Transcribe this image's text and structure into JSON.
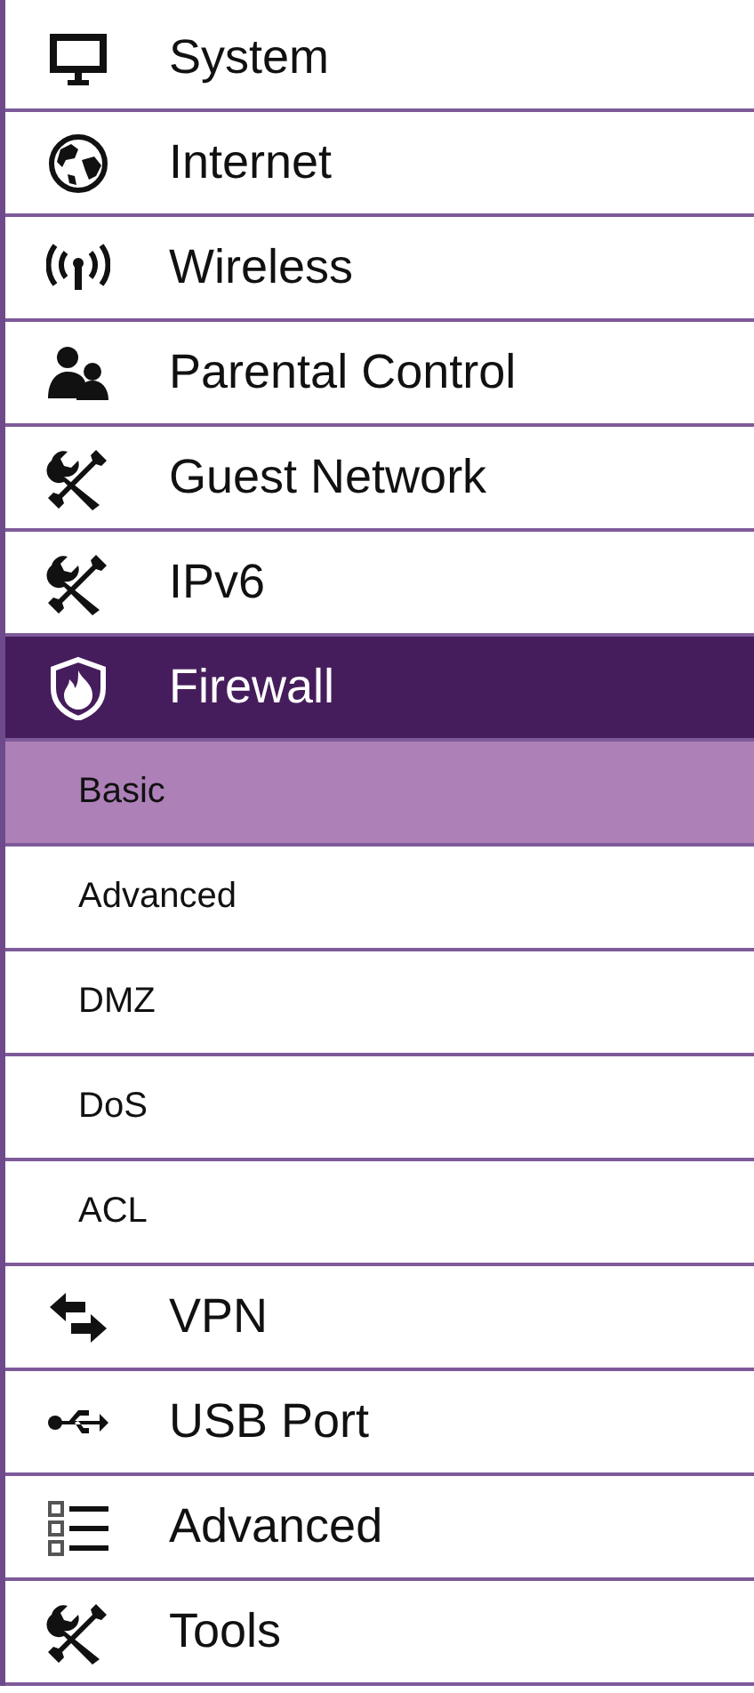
{
  "menu": [
    {
      "kind": "main",
      "label": "System",
      "selected": false
    },
    {
      "kind": "main",
      "label": "Internet",
      "selected": false
    },
    {
      "kind": "main",
      "label": "Wireless",
      "selected": false
    },
    {
      "kind": "main",
      "label": "Parental Control",
      "selected": false
    },
    {
      "kind": "main",
      "label": "Guest Network",
      "selected": false
    },
    {
      "kind": "main",
      "label": "IPv6",
      "selected": false
    },
    {
      "kind": "main",
      "label": "Firewall",
      "selected": true
    },
    {
      "kind": "sub",
      "label": "Basic",
      "selected": true
    },
    {
      "kind": "sub",
      "label": "Advanced",
      "selected": false
    },
    {
      "kind": "sub",
      "label": "DMZ",
      "selected": false
    },
    {
      "kind": "sub",
      "label": "DoS",
      "selected": false
    },
    {
      "kind": "sub",
      "label": "ACL",
      "selected": false
    },
    {
      "kind": "main",
      "label": "VPN",
      "selected": false
    },
    {
      "kind": "main",
      "label": "USB Port",
      "selected": false
    },
    {
      "kind": "main",
      "label": "Advanced",
      "selected": false
    },
    {
      "kind": "main",
      "label": "Tools",
      "selected": false
    }
  ]
}
